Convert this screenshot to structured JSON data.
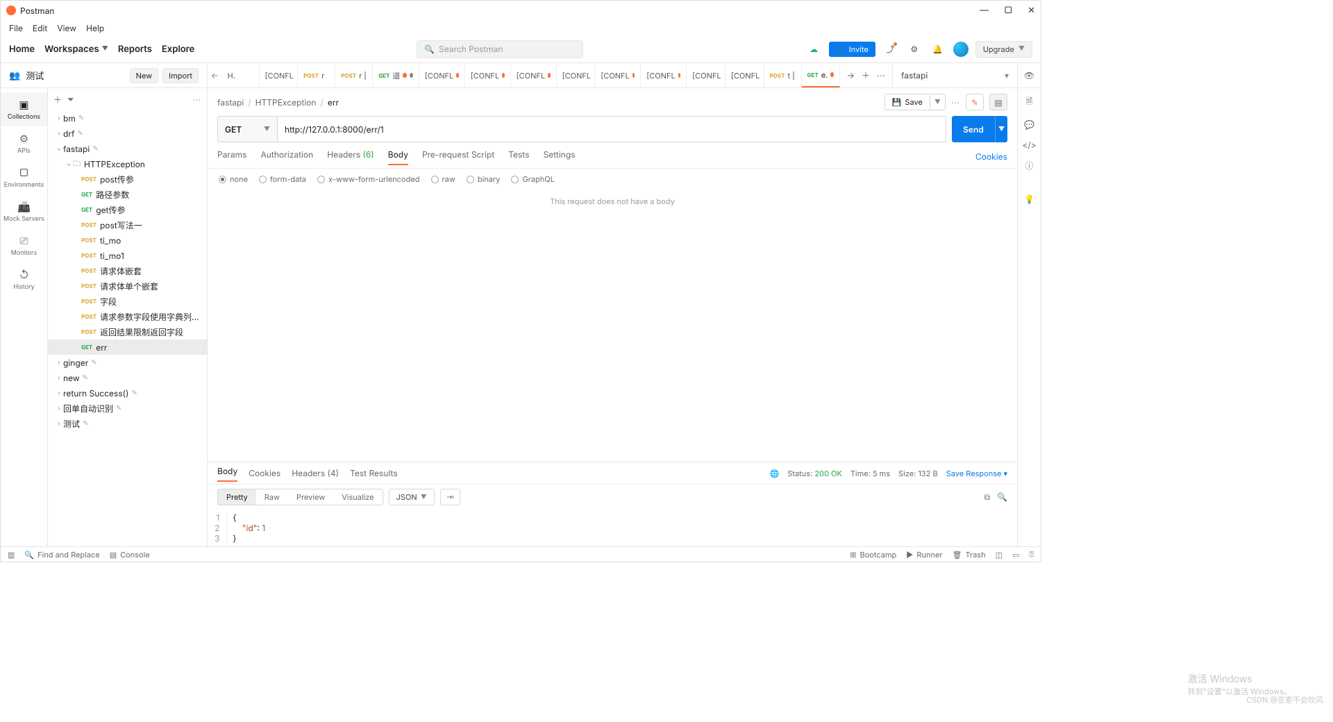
{
  "app": {
    "title": "Postman"
  },
  "menus": [
    "File",
    "Edit",
    "View",
    "Help"
  ],
  "topnav": {
    "home": "Home",
    "workspaces": "Workspaces",
    "reports": "Reports",
    "explore": "Explore"
  },
  "search": {
    "placeholder": "Search Postman"
  },
  "invite": "Invite",
  "upgrade": "Upgrade",
  "workspace": {
    "name": "测试",
    "new": "New",
    "import": "Import"
  },
  "tabs": [
    {
      "method": "",
      "label": "H.",
      "unsaved": false
    },
    {
      "method": "",
      "label": "[CONFL",
      "unsaved": false
    },
    {
      "method": "POST",
      "label": "r",
      "unsaved": false
    },
    {
      "method": "POST",
      "label": "r",
      "unsaved": false,
      "bar": true
    },
    {
      "method": "GET",
      "label": "道",
      "unsaved2": true
    },
    {
      "method": "",
      "label": "[CONFL",
      "unsaved": true
    },
    {
      "method": "",
      "label": "[CONFL",
      "unsaved": true
    },
    {
      "method": "",
      "label": "[CONFL",
      "unsaved": true
    },
    {
      "method": "",
      "label": "[CONFL",
      "unsaved": false
    },
    {
      "method": "",
      "label": "[CONFL",
      "unsaved": true
    },
    {
      "method": "",
      "label": "[CONFL",
      "unsaved": true
    },
    {
      "method": "",
      "label": "[CONFL",
      "unsaved": false
    },
    {
      "method": "",
      "label": "[CONFL",
      "unsaved": false
    },
    {
      "method": "POST",
      "label": "t",
      "unsaved": false,
      "bar": true
    },
    {
      "method": "GET",
      "label": "e.",
      "unsaved": true,
      "active": true
    }
  ],
  "env": "fastapi",
  "siderail": [
    {
      "label": "Collections",
      "icon": "▣"
    },
    {
      "label": "APIs",
      "icon": "⚙"
    },
    {
      "label": "Environments",
      "icon": "▢"
    },
    {
      "label": "Mock Servers",
      "icon": "📠"
    },
    {
      "label": "Monitors",
      "icon": "⎚"
    },
    {
      "label": "History",
      "icon": "↺"
    }
  ],
  "tree": {
    "top": [
      {
        "name": "bm"
      },
      {
        "name": "drf"
      }
    ],
    "fastapi": "fastapi",
    "folder": "HTTPException",
    "items": [
      {
        "m": "POST",
        "name": "post传参"
      },
      {
        "m": "GET",
        "name": "路径参数"
      },
      {
        "m": "GET",
        "name": "get传参"
      },
      {
        "m": "POST",
        "name": "post写法一"
      },
      {
        "m": "POST",
        "name": "ti_mo"
      },
      {
        "m": "POST",
        "name": "ti_mo1"
      },
      {
        "m": "POST",
        "name": "请求体嵌套"
      },
      {
        "m": "POST",
        "name": "请求体单个嵌套"
      },
      {
        "m": "POST",
        "name": "字段"
      },
      {
        "m": "POST",
        "name": "请求参数字段使用字典列表集合..."
      },
      {
        "m": "POST",
        "name": "返回结果限制返回字段"
      },
      {
        "m": "GET",
        "name": "err",
        "active": true
      }
    ],
    "bottom": [
      {
        "name": "ginger"
      },
      {
        "name": "new"
      },
      {
        "name": "return Success()"
      },
      {
        "name": "回单自动识别"
      },
      {
        "name": "测试"
      }
    ]
  },
  "breadcrumbs": [
    "fastapi",
    "HTTPException",
    "err"
  ],
  "save": "Save",
  "request": {
    "method": "GET",
    "url": "http://127.0.0.1:8000/err/1",
    "send": "Send",
    "tabs": {
      "params": "Params",
      "auth": "Authorization",
      "headers": "Headers",
      "headers_count": "(6)",
      "body": "Body",
      "prereq": "Pre-request Script",
      "tests": "Tests",
      "settings": "Settings",
      "cookies": "Cookies"
    },
    "body_types": {
      "none": "none",
      "form": "form-data",
      "xwww": "x-www-form-urlencoded",
      "raw": "raw",
      "binary": "binary",
      "graphql": "GraphQL"
    },
    "nobody": "This request does not have a body"
  },
  "response": {
    "tabs": {
      "body": "Body",
      "cookies": "Cookies",
      "headers": "Headers",
      "headers_count": "(4)",
      "tests": "Test Results"
    },
    "status_label": "Status:",
    "status_value": "200 OK",
    "time_label": "Time:",
    "time_value": "5 ms",
    "size_label": "Size:",
    "size_value": "132 B",
    "save": "Save Response",
    "fmt": {
      "pretty": "Pretty",
      "raw": "Raw",
      "preview": "Preview",
      "visualize": "Visualize",
      "lang": "JSON"
    },
    "code": {
      "l1": "{",
      "l2_key": "\"id\"",
      "l2_sep": ": ",
      "l2_val": "1",
      "l3": "}"
    }
  },
  "statusbar": {
    "find": "Find and Replace",
    "console": "Console",
    "bootcamp": "Bootcamp",
    "runner": "Runner",
    "trash": "Trash"
  },
  "watermark": {
    "title": "激活 Windows",
    "sub": "转到\"设置\"以激活 Windows。"
  },
  "csdn": "CSDN @亚索不会吹风"
}
